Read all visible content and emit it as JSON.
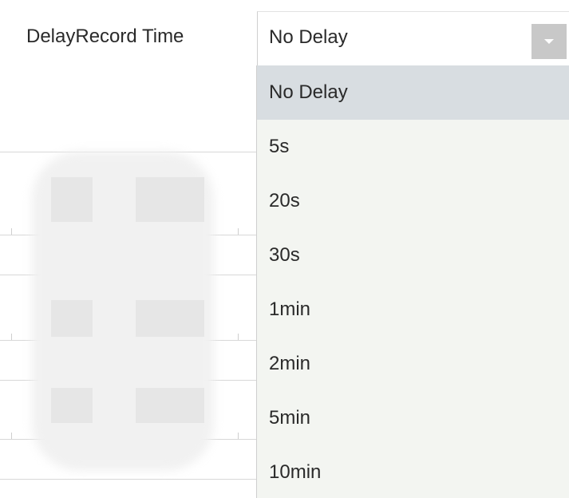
{
  "form": {
    "label": "DelayRecord Time",
    "select": {
      "value": "No Delay",
      "options": [
        {
          "label": "No Delay",
          "selected": true
        },
        {
          "label": "5s",
          "selected": false
        },
        {
          "label": "20s",
          "selected": false
        },
        {
          "label": "30s",
          "selected": false
        },
        {
          "label": "1min",
          "selected": false
        },
        {
          "label": "2min",
          "selected": false
        },
        {
          "label": "5min",
          "selected": false
        },
        {
          "label": "10min",
          "selected": false
        }
      ]
    }
  },
  "colors": {
    "selected_option_bg": "#d8dde1",
    "dropdown_bg": "#f3f5f1",
    "arrow_button_bg": "#c8c8c8"
  },
  "icons": {
    "select_arrow": "chevron-down-icon"
  }
}
